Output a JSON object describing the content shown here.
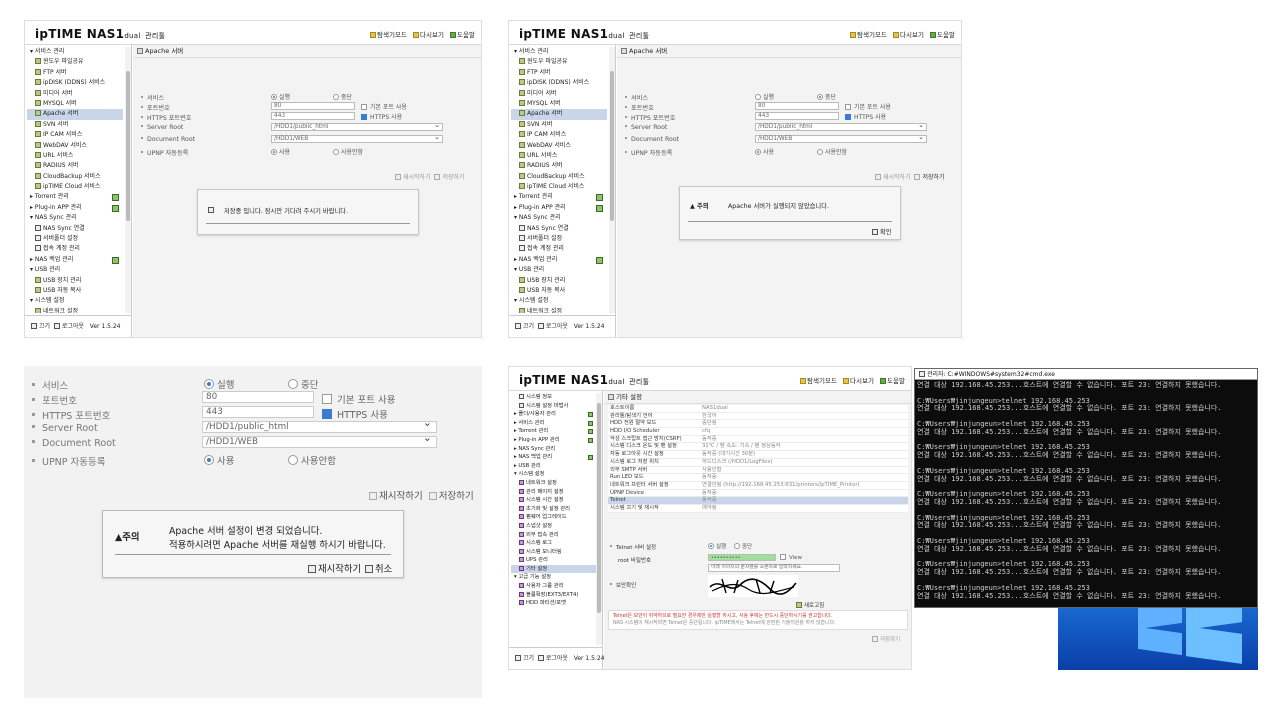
{
  "app": {
    "logo": "ipTIME",
    "model": "NAS1",
    "model_suffix": "dual",
    "logo_suffix": "관리툴",
    "links": [
      "탐색기모드",
      "다시보기",
      "도움말"
    ],
    "version": "Ver 1.5.24",
    "footer_close": "끄기",
    "footer_logout": "로그아웃"
  },
  "sidebar": {
    "items": [
      {
        "label": "서비스 관리",
        "kind": "group"
      },
      {
        "label": "윈도우 파일공유",
        "kind": "child"
      },
      {
        "label": "FTP 서버",
        "kind": "child"
      },
      {
        "label": "ipDISK (DDNS) 서비스",
        "kind": "child"
      },
      {
        "label": "미디어 서버",
        "kind": "child"
      },
      {
        "label": "MYSQL 서버",
        "kind": "child"
      },
      {
        "label": "Apache 서버",
        "kind": "child",
        "selected": true
      },
      {
        "label": "SVN 서버",
        "kind": "child"
      },
      {
        "label": "IP CAM 서비스",
        "kind": "child"
      },
      {
        "label": "WebDAV 서비스",
        "kind": "child"
      },
      {
        "label": "URL 서비스",
        "kind": "child"
      },
      {
        "label": "RADIUS 서버",
        "kind": "child"
      },
      {
        "label": "CloudBackup 서비스",
        "kind": "child"
      },
      {
        "label": "ipTIME Cloud 서비스",
        "kind": "child"
      },
      {
        "label": "Torrent 관리",
        "kind": "group"
      },
      {
        "label": "Plug-in APP 관리",
        "kind": "group"
      },
      {
        "label": "NAS Sync 관리",
        "kind": "group"
      },
      {
        "label": "NAS Sync 연결",
        "kind": "child"
      },
      {
        "label": "서버폴더 설정",
        "kind": "child"
      },
      {
        "label": "접속 계정 관리",
        "kind": "child"
      },
      {
        "label": "NAS 백업 관리",
        "kind": "group"
      },
      {
        "label": "USB 관리",
        "kind": "group"
      },
      {
        "label": "USB 장치 관리",
        "kind": "child"
      },
      {
        "label": "USB 자동 복사",
        "kind": "child"
      },
      {
        "label": "시스템 설정",
        "kind": "group"
      },
      {
        "label": "네트워크 설정",
        "kind": "child"
      }
    ]
  },
  "apache": {
    "title": "Apache 서버",
    "labels": {
      "service": "서비스",
      "port": "포트번호",
      "https_port": "HTTPS 포트번호",
      "server_root": "Server Root",
      "document_root": "Document Root",
      "upnp": "UPNP 자동등록"
    },
    "run": "실행",
    "stop": "중단",
    "port": "80",
    "default_port": "기본 포트 사용",
    "https_port": "443",
    "https_use": "HTTPS 사용",
    "server_root": "/HDD1/public_html",
    "document_root": "/HDD1/WEB",
    "use": "사용",
    "nouse": "사용안함",
    "restart": "재시작하기",
    "save": "저장하기"
  },
  "dialogs": {
    "saving": "저장중 입니다. 잠시만 기다려 주시기 바랍니다.",
    "warn_title": "주의",
    "not_running": "Apache 서버가 실행되지 않았습니다.",
    "ok": "확인",
    "changed_line1": "Apache 서버 설정이 변경 되었습니다.",
    "changed_line2": "적용하시려면 Apache 서버를 재실행 하시기 바랍니다.",
    "restart": "재시작하기",
    "cancel": "취소"
  },
  "pane4": {
    "sidebar": [
      "시스템 정보",
      "시스템 설정 마법사",
      "폴더/사용자 관리",
      "서비스 관리",
      "Torrent 관리",
      "Plug-in APP 관리",
      "NAS Sync 관리",
      "NAS 백업 관리",
      "USB 관리",
      "시스템 설정",
      "네트워크 설정",
      "관리 페이지 설정",
      "시스템 시간 설정",
      "초기화 및 설정 관리",
      "펌웨어 업그레이드",
      "스냅샷 설정",
      "외부 접속 관리",
      "시스템 로그",
      "시스템 모니터링",
      "UPS 관리",
      "기타 설정",
      "고급 기능 설정",
      "사용자 그룹 관리",
      "볼륨확장(EXT3/EXT4)",
      "HDD 파티션/포맷"
    ],
    "title": "기타 설정",
    "table": [
      [
        "호스트이름",
        "NAS1dual"
      ],
      [
        "관리툴/탐색기 언어",
        "한국어"
      ],
      [
        "HDD 전원 절약 모드",
        "중단됨"
      ],
      [
        "HDD I/O Scheduler",
        "cfq"
      ],
      [
        "악성 스크립트 접근 방지(CSRF)",
        "동작중"
      ],
      [
        "시스템 디스크 온도 및 팬 설정",
        "31℃ / 팬 속도: 기속 / 팬 정상동작"
      ],
      [
        "자동 로그아웃 시간 설정",
        "동작중 (대기시간 30분)"
      ],
      [
        "시스템 로그 저장 위치",
        "하드디스크 (/HDD1/LogFiles)"
      ],
      [
        "외부 SMTP 서버",
        "사용안함"
      ],
      [
        "Run LED 모드",
        "동작중"
      ],
      [
        "네트워크 프린터 서버 설정",
        "연결안됨 (http://192.168.45.253:631/printers/ipTIME_Printer)"
      ],
      [
        "UPNP Device",
        "동작중"
      ],
      [
        "Telnet",
        "동작중"
      ],
      [
        "시스템 끄기 및 재시작",
        "예약됨"
      ]
    ],
    "telnet_label": "Telnet 서버 설정",
    "run": "실행",
    "stop": "중단",
    "pw_label": "root 비밀번호",
    "pw_value": "••••••••••",
    "view": "View",
    "captcha_hint": "이래 이미지의 문자열을 소문자로 입력하세요.",
    "captcha_label": "보안확인",
    "refresh": "새로고침",
    "warning1": "Telnet은 보안이 취약하므로 필요한 경우에만 실행할 하시고, 사용 후에는 반드시 중단하시기를 권고합니다.",
    "warning2": "NAS 시스템이 재시작되면 Telnet은 중단됩니다. ipTIME에서는 Telnet에 관련된 기술지원을 하지 않습니다.",
    "save": "저장하기"
  },
  "cmd": {
    "title": "관리자: C:#WINDOWS#system32#cmd.exe",
    "prompt_line": "C:₩Users₩jinjungeun>telnet 192.168.45.253",
    "error_line": "연결 대상 192.168.45.253...호스트에 연결할 수 없습니다. 포트 23: 연결하지 못했습니다.",
    "final_prompt": "C:₩Users₩jinjungeun>"
  }
}
